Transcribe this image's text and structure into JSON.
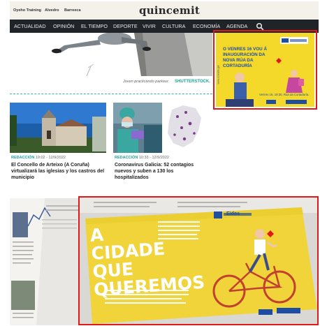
{
  "topbar": {
    "links": [
      "Oyeho Training",
      "Alvedro",
      "Barreeca"
    ],
    "logo": "quincemit"
  },
  "nav": {
    "items": [
      "ACTUALIDAD",
      "OPINIÓN",
      "EL TIEMPO",
      "DEPORTE",
      "VIVIR",
      "CULTURA",
      "ECONOMÍA",
      "AGENDA"
    ],
    "search_icon": "search-icon"
  },
  "hero": {
    "caption": "Joven practicando parkour.",
    "credit": "SHUTTERSTOCK."
  },
  "ad": {
    "headline": "O VENRES 16 VOU Á INAUGURACIÓN DA NOVA RÚA DA CORTADURÍA",
    "date_line": "Venres 16, 19:30, Rúa da Cortaduría.",
    "side_text": "www.concello.gal"
  },
  "articles": [
    {
      "source": "REDACCIÓN",
      "date": "19:02 - 12/9/2022",
      "title": "El Concello de Arteixo (A Coruña) virtualizará las iglesias y los castros del municipio"
    },
    {
      "source": "REDACCIÓN",
      "date": "10:33 - 12/9/2022",
      "title": "Coronavirus Galicia: 52 contagios nuevos y suben a 130 los hospitalizados"
    }
  ],
  "print_ad": {
    "headline": "A CIDADE QUE QUEREMOS",
    "brand": "Eidos",
    "colors": {
      "accent": "#e01818",
      "teal": "#1aa39a",
      "ad_yellow": "#f4d92a",
      "nav": "#1f2428"
    }
  }
}
